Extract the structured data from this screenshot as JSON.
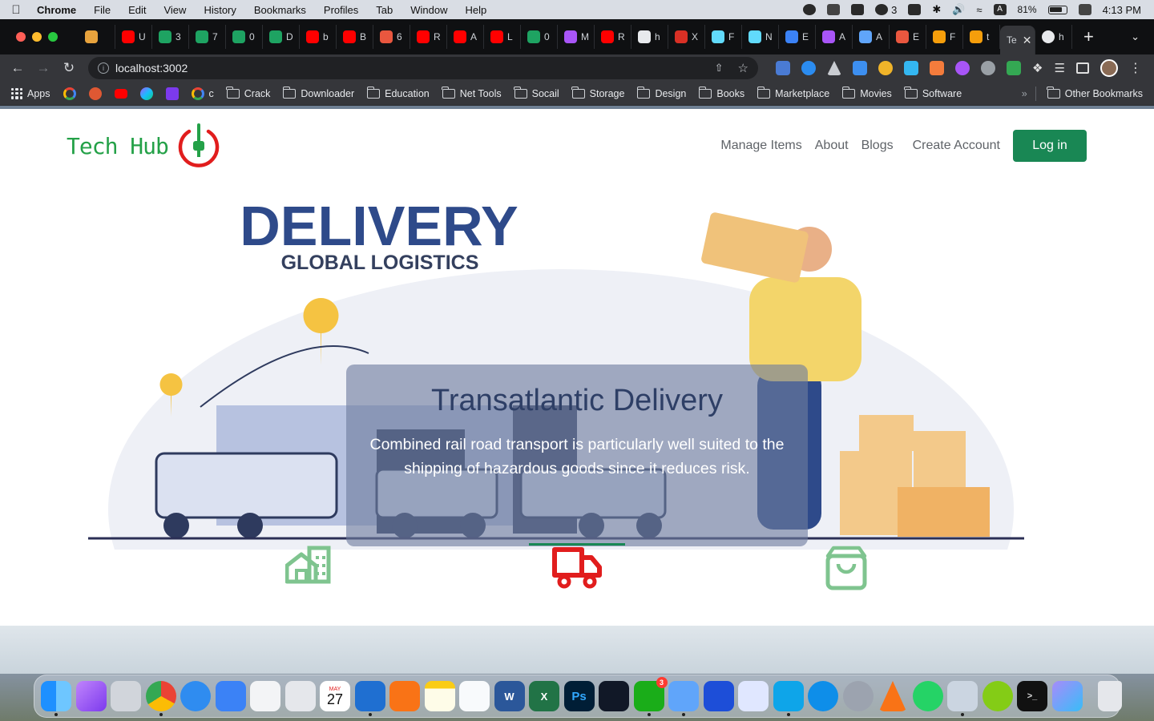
{
  "menubar": {
    "app_name": "Chrome",
    "items": [
      "File",
      "Edit",
      "View",
      "History",
      "Bookmarks",
      "Profiles",
      "Tab",
      "Window",
      "Help"
    ],
    "wechat_count": "3",
    "battery": "81%",
    "time": "4:13 PM"
  },
  "tabs": [
    {
      "letter": "",
      "color": "#e8a33d"
    },
    {
      "letter": "U",
      "color": "#ff0000"
    },
    {
      "letter": "3",
      "color": "#1ea362"
    },
    {
      "letter": "7",
      "color": "#1ea362"
    },
    {
      "letter": "0",
      "color": "#1ea362"
    },
    {
      "letter": "D",
      "color": "#1ea362"
    },
    {
      "letter": "b",
      "color": "#ff0000"
    },
    {
      "letter": "B",
      "color": "#ff0000"
    },
    {
      "letter": "6",
      "color": "#e9573f"
    },
    {
      "letter": "R",
      "color": "#ff0000"
    },
    {
      "letter": "A",
      "color": "#ff0000"
    },
    {
      "letter": "L",
      "color": "#ff0000"
    },
    {
      "letter": "0",
      "color": "#1ea362"
    },
    {
      "letter": "M",
      "color": "#a855f7"
    },
    {
      "letter": "R",
      "color": "#ff0000"
    },
    {
      "letter": "h",
      "color": "#e8eaed"
    },
    {
      "letter": "X",
      "color": "#d93025"
    },
    {
      "letter": "F",
      "color": "#61dafb"
    },
    {
      "letter": "N",
      "color": "#61dafb"
    },
    {
      "letter": "E",
      "color": "#3b82f6"
    },
    {
      "letter": "A",
      "color": "#a855f7"
    },
    {
      "letter": "A",
      "color": "#60a5fa"
    },
    {
      "letter": "E",
      "color": "#e9573f"
    },
    {
      "letter": "F",
      "color": "#f59e0b"
    },
    {
      "letter": "t",
      "color": "#f59e0b"
    }
  ],
  "active_tab": {
    "letter": "Te"
  },
  "last_tab": {
    "letter": "h"
  },
  "address": {
    "url": "localhost:3002"
  },
  "bookmarks": {
    "apps_label": "Apps",
    "c_label": "c",
    "folders": [
      "Crack",
      "Downloader",
      "Education",
      "Net Tools",
      "Socail",
      "Storage",
      "Design",
      "Books",
      "Marketplace",
      "Movies",
      "Software"
    ],
    "overflow": "»",
    "other": "Other Bookmarks"
  },
  "site": {
    "brand": "Tech Hub",
    "nav": {
      "manage_items": "Manage Items",
      "about": "About",
      "blogs": "Blogs",
      "create_account": "Create Account",
      "login": "Log in"
    }
  },
  "hero": {
    "image_title": "DELIVERY",
    "image_subtitle": "GLOBAL LOGISTICS",
    "caption_title": "Transatlantic Delivery",
    "caption_text": "Combined rail road transport is particularly well suited to the shipping of hazardous goods since it reduces risk.",
    "colors": {
      "accent": "#198754",
      "active_icon": "#e11d1d",
      "inactive_icon": "#7fc48f"
    }
  },
  "dock": {
    "calendar_month": "MAY",
    "calendar_day": "27",
    "wechat_badge": "3"
  }
}
